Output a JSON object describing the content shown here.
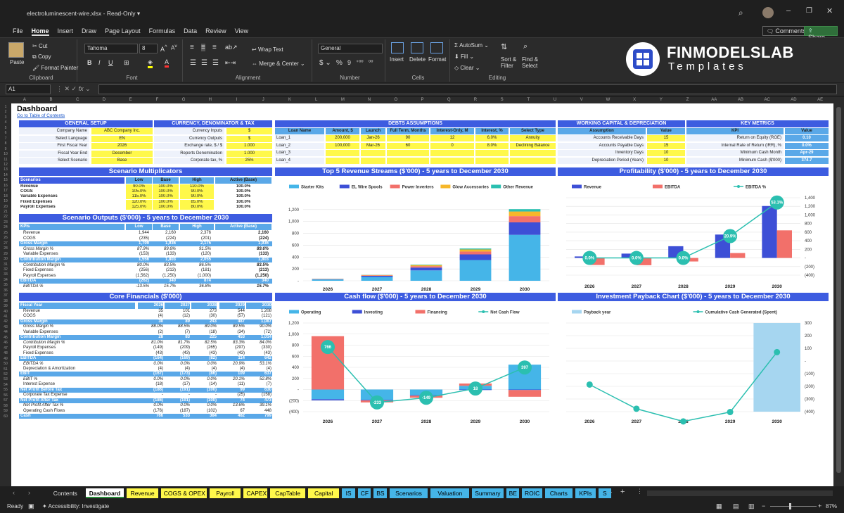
{
  "window": {
    "title": "electroluminescent-wire.xlsx  -  Read-Only ▾",
    "comments": "Comments",
    "share": "Share"
  },
  "menu": [
    "File",
    "Home",
    "Insert",
    "Draw",
    "Page Layout",
    "Formulas",
    "Data",
    "Review",
    "View"
  ],
  "ribbon": {
    "clipboard": {
      "paste": "Paste",
      "cut": "Cut",
      "copy": "Copy",
      "painter": "Format Painter",
      "label": "Clipboard"
    },
    "font": {
      "name": "Tahoma",
      "size": "8",
      "label": "Font"
    },
    "alignment": {
      "wrap": "Wrap Text",
      "merge": "Merge & Center",
      "label": "Alignment"
    },
    "number": {
      "format": "General",
      "label": "Number"
    },
    "cells": {
      "insert": "Insert",
      "delete": "Delete",
      "format": "Format",
      "label": "Cells"
    },
    "editing": {
      "autosum": "AutoSum",
      "fill": "Fill",
      "clear": "Clear",
      "sort": "Sort & Filter",
      "find": "Find & Select",
      "label": "Editing"
    },
    "brand": {
      "name": "FINMODELSLAB",
      "sub": "Templates"
    }
  },
  "namebox": "A1",
  "columns": [
    "A",
    "B",
    "C",
    "D",
    "E",
    "F",
    "G",
    "H",
    "I",
    "J",
    "K",
    "L",
    "M",
    "N",
    "O",
    "P",
    "Q",
    "R",
    "S",
    "T",
    "U",
    "V",
    "W",
    "X",
    "Y",
    "Z",
    "AA",
    "AB",
    "AC",
    "AD",
    "AE"
  ],
  "sheet": {
    "title": "Dashboard",
    "toc": "Go to Table of Contents",
    "general": {
      "title": "GENERAL SETUP",
      "rows": [
        [
          "Company Name",
          "ABC Company Inc."
        ],
        [
          "Select Language",
          "EN"
        ],
        [
          "First Fiscal Year",
          "2026"
        ],
        [
          "Fiscal Year End",
          "December"
        ],
        [
          "Select Scenario",
          "Base"
        ]
      ]
    },
    "currency": {
      "title": "CURRENCY, DENOMINATOR & TAX",
      "rows": [
        [
          "Currency Inputs",
          "$"
        ],
        [
          "Currency Outputs",
          "$"
        ],
        [
          "Exchange rate, $ / $",
          "1.000"
        ],
        [
          "Reports Denomination",
          "1.000"
        ],
        [
          "Corporate tax, %",
          "25%"
        ]
      ]
    },
    "debts": {
      "title": "DEBTS ASSUMPTIONS",
      "headers": [
        "Loan Name",
        "Amount, $",
        "Launch",
        "Full Term, Months",
        "Interest-Only, M",
        "Interest, %",
        "Select Type"
      ],
      "rows": [
        [
          "Loan_1",
          "200,000",
          "Jan-26",
          "90",
          "12",
          "6.0%",
          "Annuity"
        ],
        [
          "Loan_2",
          "100,000",
          "Mar-26",
          "60",
          "0",
          "8.0%",
          "Declining Balance"
        ],
        [
          "Loan_3",
          "",
          "",
          "",
          "",
          "",
          ""
        ],
        [
          "Loan_4",
          "",
          "",
          "",
          "",
          "",
          ""
        ]
      ]
    },
    "wc": {
      "title": "WORKING CAPITAL & DEPRECIATION",
      "headers": [
        "Assumption",
        "Value"
      ],
      "rows": [
        [
          "Accounts Receivable Days",
          "15"
        ],
        [
          "Accounts Payable Days",
          "15"
        ],
        [
          "Inventory Days",
          "10"
        ],
        [
          "Depreciation Period (Years)",
          "10"
        ]
      ]
    },
    "kpi": {
      "title": "KEY METRICS",
      "headers": [
        "KPI",
        "Value"
      ],
      "rows": [
        [
          "Return on Equity (ROE)",
          "0.10"
        ],
        [
          "Internal Rate of Return (IRR), %",
          "0.0%"
        ],
        [
          "Minimum Cash Month",
          "Apr-29"
        ],
        [
          "Minimum Cash ($'000)",
          "374.7"
        ]
      ]
    },
    "multipliers": {
      "title": "Scenario Multiplicators",
      "headers": [
        "Scenarios",
        "Low",
        "Base",
        "High",
        "Active (Base)"
      ],
      "rows": [
        [
          "Revenue",
          "90.0%",
          "100.0%",
          "110.0%",
          "100.0%"
        ],
        [
          "COGS",
          "105.0%",
          "100.0%",
          "90.0%",
          "100.0%"
        ],
        [
          "Variable Expenses",
          "115.0%",
          "100.0%",
          "90.0%",
          "100.0%"
        ],
        [
          "Fixed Expenses",
          "120.0%",
          "100.0%",
          "85.0%",
          "100.0%"
        ],
        [
          "Payroll Expenses",
          "125.0%",
          "100.0%",
          "80.0%",
          "100.0%"
        ]
      ]
    },
    "outputs": {
      "title": "Scenario Outputs ($'000) - 5 years to December 2030",
      "headers": [
        "KPIs",
        "Low",
        "Base",
        "High",
        "Active (Base)"
      ],
      "rows": [
        [
          "Revenue",
          "1,944",
          "2,160",
          "2,376",
          "2,160",
          "n"
        ],
        [
          "COGS",
          "(235)",
          "(224)",
          "(201)",
          "(224)",
          "n"
        ],
        [
          "Gross Margin",
          "1,709",
          "1,936",
          "2,175",
          "1,936",
          "h"
        ],
        [
          "Gross Margin %",
          "87.9%",
          "89.6%",
          "91.5%",
          "89.6%",
          "i"
        ],
        [
          "Variable Expenses",
          "(153)",
          "(133)",
          "(120)",
          "(133)",
          "n"
        ],
        [
          "Contribution Margin",
          "1,556",
          "1,803",
          "2,055",
          "1,803",
          "h"
        ],
        [
          "Contribution Margin %",
          "80.0%",
          "83.5%",
          "86.5%",
          "83.5%",
          "i"
        ],
        [
          "Fixed Expenses",
          "(256)",
          "(213)",
          "(181)",
          "(213)",
          "n"
        ],
        [
          "Payroll Expenses",
          "(1,562)",
          "(1,250)",
          "(1,000)",
          "(1,250)",
          "n"
        ],
        [
          "EBITDA",
          "(262)",
          "340",
          "874",
          "340",
          "h"
        ],
        [
          "EBITDA %",
          "-13.5%",
          "15.7%",
          "36.8%",
          "15.7%",
          "i"
        ]
      ]
    },
    "core": {
      "title": "Core Financials ($'000)",
      "headers": [
        "Fiscal Year",
        "2026",
        "2027",
        "2028",
        "2029",
        "2030"
      ],
      "rows": [
        [
          "Revenue",
          "35",
          "101",
          "273",
          "544",
          "1,208",
          "n"
        ],
        [
          "COGS",
          "(4)",
          "(12)",
          "(30)",
          "(57)",
          "(121)",
          "n"
        ],
        [
          "Gross Margin",
          "30",
          "89",
          "243",
          "487",
          "1,087",
          "h"
        ],
        [
          "Gross Margin %",
          "88.0%",
          "88.5%",
          "89.0%",
          "89.5%",
          "90.0%",
          "i"
        ],
        [
          "Variable Expenses",
          "(2)",
          "(7)",
          "(18)",
          "(34)",
          "(72)",
          "n"
        ],
        [
          "Contribution Margin",
          "28",
          "83",
          "225",
          "453",
          "1,014",
          "h"
        ],
        [
          "Contribution Margin %",
          "81.0%",
          "81.7%",
          "82.5%",
          "83.3%",
          "84.0%",
          "i"
        ],
        [
          "Payroll Expenses",
          "(149)",
          "(209)",
          "(265)",
          "(297)",
          "(330)",
          "n"
        ],
        [
          "Fixed Expenses",
          "(43)",
          "(43)",
          "(43)",
          "(43)",
          "(43)",
          "n"
        ],
        [
          "EBITDA",
          "(164)",
          "(169)",
          "(82)",
          "114",
          "642",
          "h"
        ],
        [
          "EBITDA %",
          "0.0%",
          "0.0%",
          "0.0%",
          "20.9%",
          "53.1%",
          "i"
        ],
        [
          "Depreciation & Amortization",
          "(4)",
          "(4)",
          "(4)",
          "(4)",
          "(4)",
          "n"
        ],
        [
          "EBIT",
          "(167)",
          "(173)",
          "(86)",
          "109",
          "637",
          "h"
        ],
        [
          "EBIT %",
          "0.0%",
          "0.0%",
          "0.0%",
          "20.1%",
          "52.8%",
          "i"
        ],
        [
          "Interest Expense",
          "(18)",
          "(17)",
          "(14)",
          "(11)",
          "(7)",
          "n"
        ],
        [
          "Net Profit Before Tax",
          "(186)",
          "(191)",
          "(100)",
          "99",
          "630",
          "h"
        ],
        [
          "Corporate Tax Expense",
          "-",
          "-",
          "-",
          "(25)",
          "(158)",
          "n"
        ],
        [
          "Net Profit After Tax",
          "(186)",
          "(191)",
          "(100)",
          "74",
          "473",
          "h"
        ],
        [
          "Net Profit After Tax %",
          "0.0%",
          "0.0%",
          "0.0%",
          "13.6%",
          "39.1%",
          "i"
        ],
        [
          "Operating Cash Flows",
          "(176)",
          "(187)",
          "(102)",
          "67",
          "448",
          "n"
        ],
        [
          "Cash",
          "766",
          "533",
          "384",
          "482",
          "799",
          "h"
        ]
      ]
    }
  },
  "charts": {
    "revenue": {
      "title": "Top 5 Revenue Streams ($'000) - 5 years to December 2030"
    },
    "profit": {
      "title": "Profitability ($'000) - 5 years to December 2030"
    },
    "cash": {
      "title": "Cash flow ($'000) - 5 years to December 2030"
    },
    "payback": {
      "title": "Investment Payback Chart ($'000) - 5 years to December 2030"
    }
  },
  "chart_data": [
    {
      "type": "bar",
      "stacked": true,
      "title": "Top 5 Revenue Streams ($'000) - 5 years to December 2030",
      "categories": [
        "2026",
        "2027",
        "2028",
        "2029",
        "2030"
      ],
      "series": [
        {
          "name": "Starter Kits",
          "color": "#45b5e8",
          "values": [
            22,
            65,
            175,
            350,
            775
          ]
        },
        {
          "name": "EL Wire Spools",
          "color": "#3d4fd6",
          "values": [
            6,
            18,
            48,
            95,
            210
          ]
        },
        {
          "name": "Power Inverters",
          "color": "#f2706a",
          "values": [
            3,
            9,
            24,
            48,
            105
          ]
        },
        {
          "name": "Glow Accessories",
          "color": "#f6b72a",
          "values": [
            3,
            6,
            18,
            35,
            78
          ]
        },
        {
          "name": "Other Revenue",
          "color": "#2bbfb0",
          "values": [
            1,
            3,
            8,
            16,
            40
          ]
        }
      ],
      "ylim": [
        0,
        1400
      ],
      "ticks": [
        "-",
        "200",
        "400",
        "600",
        "800",
        "1,000",
        "1,200"
      ],
      "legend": "top"
    },
    {
      "type": "bar",
      "title": "Profitability ($'000) - 5 years to December 2030",
      "categories": [
        "2026",
        "2027",
        "2028",
        "2029",
        "2030"
      ],
      "series": [
        {
          "name": "Revenue",
          "color": "#3d4fd6",
          "values": [
            35,
            101,
            273,
            544,
            1208
          ]
        },
        {
          "name": "EBITDA",
          "color": "#f2706a",
          "values": [
            -164,
            -169,
            -82,
            114,
            642
          ]
        },
        {
          "name": "EBITDA %",
          "color": "#2bbfb0",
          "values": [
            0,
            0,
            0,
            20.9,
            53.1
          ],
          "labels": [
            "0.0%",
            "0.0%",
            "0.0%",
            "20.9%",
            "53.1%"
          ]
        }
      ],
      "ylim": [
        -400,
        1400
      ],
      "ticks": [
        "(400)",
        "(200)",
        "-",
        "200",
        "400",
        "600",
        "800",
        "1,000",
        "1,200",
        "1,400"
      ],
      "legend": "top"
    },
    {
      "type": "bar",
      "title": "Cash flow ($'000) - 5 years to December 2030",
      "categories": [
        "2026",
        "2027",
        "2028",
        "2029",
        "2030"
      ],
      "series": [
        {
          "name": "Operating",
          "color": "#45b5e8",
          "values": [
            -176,
            -187,
            -102,
            67,
            448
          ]
        },
        {
          "name": "Investing",
          "color": "#3d4fd6",
          "values": [
            -20,
            -10,
            -10,
            -10,
            -10
          ]
        },
        {
          "name": "Financing",
          "color": "#f2706a",
          "values": [
            962,
            -36,
            -37,
            41,
            -121
          ]
        },
        {
          "name": "Net Cash Flow",
          "color": "#2bbfb0",
          "values": [
            766,
            -233,
            -149,
            18,
            397
          ]
        }
      ],
      "ylim": [
        -400,
        1200
      ],
      "ticks": [
        "(400)",
        "(200)",
        "-",
        "200",
        "400",
        "600",
        "800",
        "1,000",
        "1,200"
      ],
      "legend": "top"
    },
    {
      "type": "bar",
      "title": "Investment Payback Chart ($'000) - 5 years to December 2030",
      "categories": [
        "2026",
        "2027",
        "2028",
        "2029",
        "2030"
      ],
      "series": [
        {
          "name": "Payback year",
          "color": "#a6d6f0",
          "values": [
            0,
            0,
            0,
            0,
            1
          ]
        },
        {
          "name": "Cumulative Cash Generated (Spent)",
          "color": "#2bbfb0",
          "values": [
            -186,
            -377,
            -477,
            -403,
            70
          ]
        }
      ],
      "ylim": [
        -400,
        300
      ],
      "ticks": [
        "(400)",
        "(300)",
        "(200)",
        "(100)",
        "-",
        "100",
        "200",
        "300"
      ],
      "legend": "top"
    }
  ],
  "tabs": [
    {
      "l": "Contents",
      "c": "#1f1f1f",
      "tc": "#ddd"
    },
    {
      "l": "Dashboard",
      "c": "#ffffff",
      "tc": "#000"
    },
    {
      "l": "Revenue",
      "c": "#fff84a"
    },
    {
      "l": "COGS & OPEX",
      "c": "#fff84a"
    },
    {
      "l": "Payroll",
      "c": "#fff84a"
    },
    {
      "l": "CAPEX",
      "c": "#fff84a"
    },
    {
      "l": "CapTable",
      "c": "#fff84a"
    },
    {
      "l": "Capital",
      "c": "#fff84a"
    },
    {
      "l": "IS",
      "c": "#45b5e8"
    },
    {
      "l": "CF",
      "c": "#45b5e8"
    },
    {
      "l": "BS",
      "c": "#45b5e8"
    },
    {
      "l": "Scenarios",
      "c": "#45b5e8"
    },
    {
      "l": "Valuation",
      "c": "#45b5e8"
    },
    {
      "l": "Summary",
      "c": "#45b5e8"
    },
    {
      "l": "BE",
      "c": "#45b5e8"
    },
    {
      "l": "ROIC",
      "c": "#45b5e8"
    },
    {
      "l": "Charts",
      "c": "#45b5e8"
    },
    {
      "l": "KPIs",
      "c": "#45b5e8"
    },
    {
      "l": "S",
      "c": "#45b5e8"
    }
  ],
  "status": {
    "ready": "Ready",
    "accessibility": "Accessibility: Investigate",
    "zoom": "87%"
  }
}
